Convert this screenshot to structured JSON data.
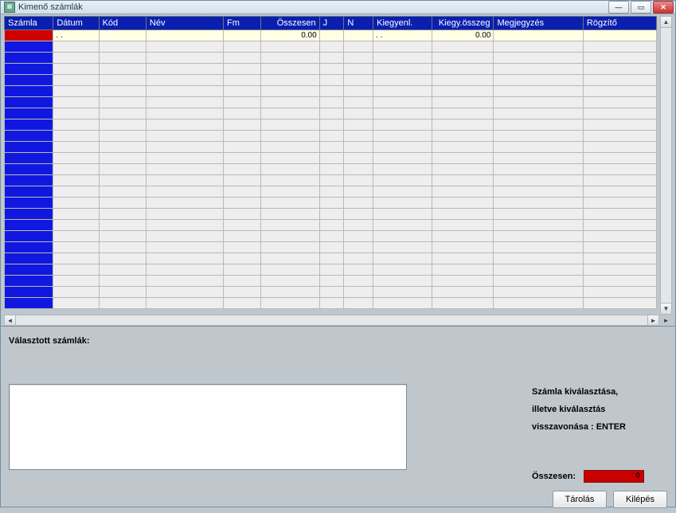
{
  "window": {
    "title": "Kimenő számlák"
  },
  "grid": {
    "columns": [
      "Számla",
      "Dátum",
      "Kód",
      "Név",
      "Fm",
      "Összesen",
      "J",
      "N",
      "Kiegyenl.",
      "Kiegy.összeg",
      "Megjegyzés",
      "Rögzítő"
    ],
    "active_row": {
      "szamla": "",
      "datum": ".  .",
      "kod": "",
      "nev": "",
      "fm": "",
      "osszesen": "0.00",
      "j": "",
      "n": "",
      "kiegyenl": ".  .",
      "kiegy_osszeg": "0.00",
      "megjegyzes": "",
      "rogzito": ""
    },
    "empty_row_count": 24
  },
  "lower": {
    "selected_label": "Választott számlák:",
    "info_lines": [
      "Számla kiválasztása,",
      "illetve kiválasztás",
      "visszavonása : ENTER"
    ],
    "total_label": "Összesen:",
    "total_value": "0",
    "buttons": {
      "store": "Tárolás",
      "exit": "Kilépés"
    }
  }
}
